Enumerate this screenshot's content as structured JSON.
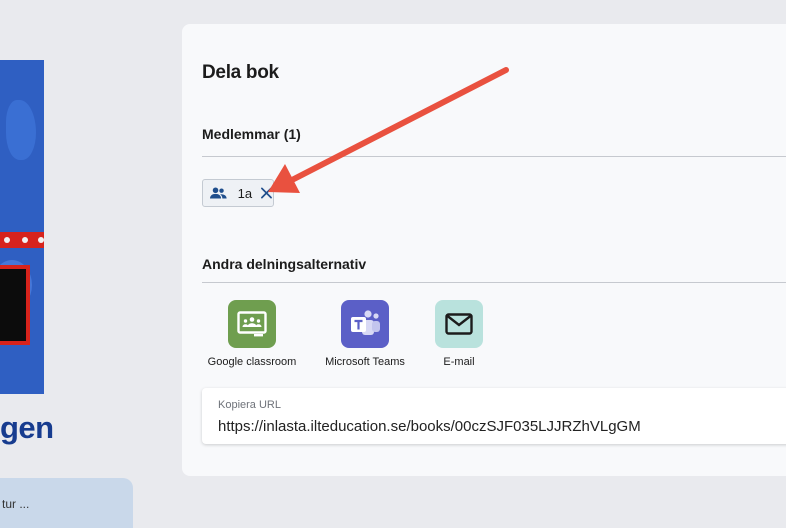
{
  "background": {
    "book_title_fragment": "gen",
    "card_text": "tur ..."
  },
  "share_panel": {
    "title": "Dela bok",
    "members": {
      "heading": "Medlemmar (1)",
      "chips": [
        {
          "label": "1a",
          "icon": "people-icon"
        }
      ]
    },
    "other_options": {
      "heading": "Andra delningsalternativ",
      "items": [
        {
          "label": "Google classroom",
          "icon": "google-classroom-icon",
          "color": "#6f9e4f"
        },
        {
          "label": "Microsoft Teams",
          "icon": "microsoft-teams-icon",
          "color": "#5b5fc7"
        },
        {
          "label": "E-mail",
          "icon": "mail-icon",
          "color": "#b9e2dd"
        }
      ]
    },
    "copy_url": {
      "label": "Kopiera URL",
      "value": "https://inlasta.ilteducation.se/books/00czSJF035LJJRZhVLgGM"
    }
  },
  "colors": {
    "annotation_arrow": "#e9513f",
    "chip_icon": "#1f4e8c"
  }
}
